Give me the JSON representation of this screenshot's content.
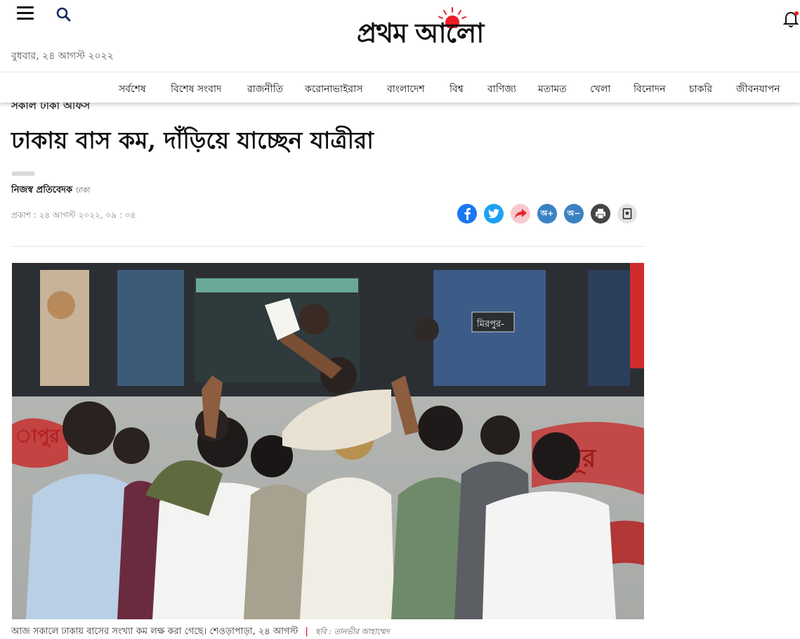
{
  "header": {
    "date": "বুধবার, ২৪ আগস্ট ২০২২",
    "logo_text": "প্রথম আলো",
    "icons": {
      "menu": "menu-icon",
      "search": "search-icon",
      "bell": "bell-icon"
    },
    "brand_color": "#ed1c24"
  },
  "nav": {
    "items": [
      "সর্বশেষ",
      "বিশেষ সংবাদ",
      "রাজনীতি",
      "করোনাভাইরাস",
      "বাংলাদেশ",
      "বিশ্ব",
      "বাণিজ্য",
      "মতামত",
      "খেলা",
      "বিনোদন",
      "চাকরি",
      "জীবনযাপন"
    ]
  },
  "article": {
    "section": "সকাল ঢাকা অফিস",
    "headline": "ঢাকায় বাস কম, দাঁড়িয়ে যাচ্ছেন যাত্রীরা",
    "author": "নিজস্ব প্রতিবেদক",
    "location": "ঢাকা",
    "published": "প্রকাশ : ২৪ আগস্ট ২০২২, ০৯ : ০৪",
    "share": {
      "facebook": {
        "icon": "facebook-icon",
        "color": "#1877f2"
      },
      "twitter": {
        "icon": "twitter-icon",
        "color": "#1da1f2"
      },
      "share": {
        "icon": "share-icon",
        "color": "#f7c9cc"
      },
      "font_plus": {
        "label": "অ+",
        "color": "#3b82c4"
      },
      "font_minus": {
        "label": "অ−",
        "color": "#3b82c4"
      },
      "print": {
        "icon": "print-icon",
        "color": "#444444"
      },
      "bookmark": {
        "icon": "bookmark-icon",
        "color": "#e3e3e3"
      }
    },
    "photo": {
      "bus_route_sign": "মিরপুর-",
      "bus_side_text_left": "াপুর",
      "bus_side_text_right": "নূর"
    },
    "caption": "আজ সকালে ঢাকায় বাসের সংখ্যা কম লক্ষ করা গেছে। শেওড়াপাড়া, ২৪ আগস্ট",
    "caption_sep": "|",
    "credit": "ছবি : তানভীর আহাম্মেদ"
  }
}
